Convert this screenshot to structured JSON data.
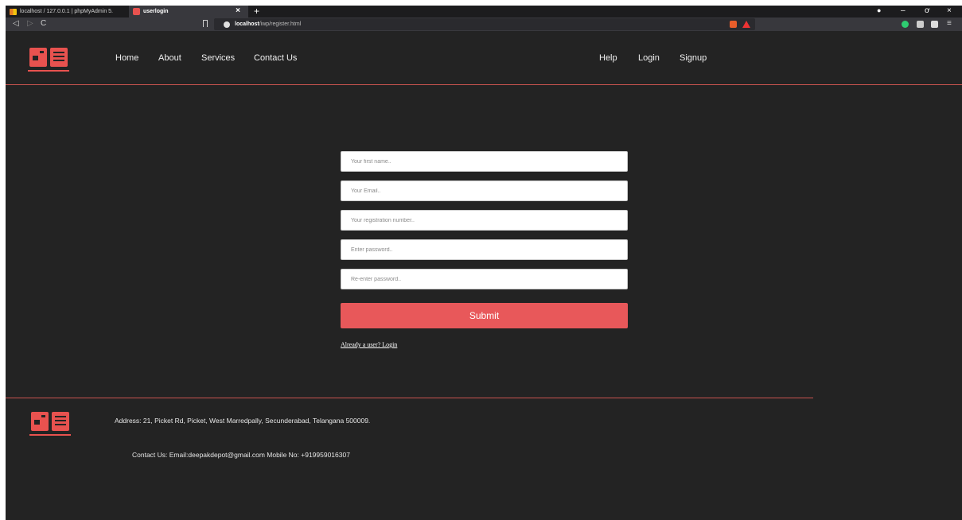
{
  "browser": {
    "tabs": [
      {
        "title": "localhost / 127.0.0.1 | phpMyAdmin 5."
      },
      {
        "title": "userlogin"
      }
    ],
    "url_host": "localhost",
    "url_path": "/iwp/register.html"
  },
  "header": {
    "nav_left": [
      "Home",
      "About",
      "Services",
      "Contact Us"
    ],
    "nav_right": [
      "Help",
      "Login",
      "Signup"
    ]
  },
  "form": {
    "first_name_placeholder": "Your first name..",
    "email_placeholder": "Your Email..",
    "reg_placeholder": "Your registration number..",
    "password_placeholder": "Enter password..",
    "repassword_placeholder": "Re-enter password..",
    "submit_label": "Submit",
    "login_link": "Already a user? Login"
  },
  "footer": {
    "address": "Address: 21, Picket Rd, Picket, West Marredpally, Secunderabad, Telangana 500009.",
    "contact": "Contact Us: Email:deepakdepot@gmail.com Mobile No: +919959016307"
  },
  "colors": {
    "accent": "#e8524f",
    "background": "#232323"
  }
}
